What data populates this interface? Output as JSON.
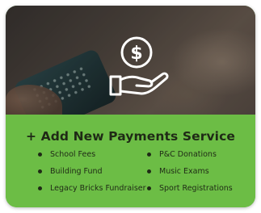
{
  "card": {
    "title": "+ Add New Payments Service",
    "accent_color": "#6cbd45",
    "hero_icon": "dollar-coin-in-hand-icon",
    "left_items": [
      {
        "label": "School Fees"
      },
      {
        "label": "Building Fund"
      },
      {
        "label": "Legacy Bricks Fundraiser"
      }
    ],
    "right_items": [
      {
        "label": "P&C Donations"
      },
      {
        "label": "Music Exams"
      },
      {
        "label": "Sport Registrations"
      }
    ]
  }
}
